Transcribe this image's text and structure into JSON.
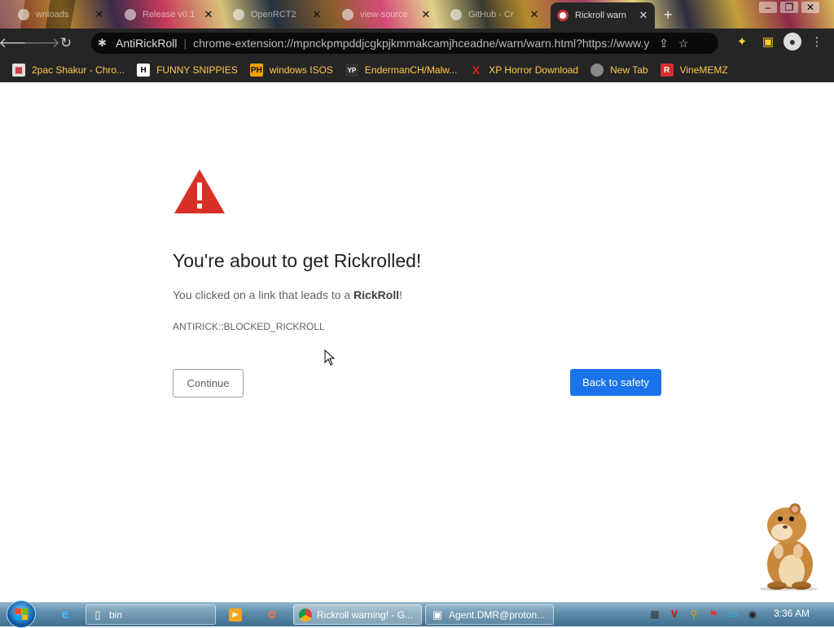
{
  "tabs": [
    {
      "title": "wnloads",
      "active": false
    },
    {
      "title": "Release v0.1",
      "active": false
    },
    {
      "title": "OpenRCT2",
      "active": false
    },
    {
      "title": "view-source",
      "active": false
    },
    {
      "title": "GitHub - Cr",
      "active": false
    },
    {
      "title": "Rickroll warn",
      "active": true
    }
  ],
  "toolbar": {
    "extension_name": "AntiRickRoll",
    "url": "chrome-extension://mpnckpmpddjcgkpjkmmakcamjhceadne/warn/warn.html?https://www.y..."
  },
  "bookmarks": [
    {
      "label": "2pac Shakur - Chro...",
      "icon": "music-icon",
      "icon_text": "",
      "color": "#e0e0e0"
    },
    {
      "label": "FUNNY SNIPPIES",
      "icon": "h-icon",
      "icon_text": "H",
      "color": "#ffffff"
    },
    {
      "label": "windows ISOS",
      "icon": "ph-icon",
      "icon_text": "PH",
      "color": "#f5a200"
    },
    {
      "label": "EndermanCH/Malw...",
      "icon": "yt-icon",
      "icon_text": "YP",
      "color": "#333333"
    },
    {
      "label": "XP Horror Download",
      "icon": "x-icon",
      "icon_text": "X",
      "color": "#e02020"
    },
    {
      "label": "New Tab",
      "icon": "newtab-icon",
      "icon_text": "",
      "color": "#888888"
    },
    {
      "label": "VineMEMZ",
      "icon": "r-icon",
      "icon_text": "R",
      "color": "#d32f2f"
    }
  ],
  "warning": {
    "heading": "You're about to get Rickrolled!",
    "sub_prefix": "You clicked on a link that leads to a ",
    "sub_bold": "RickRoll",
    "sub_suffix": "!",
    "code": "ANTIRICK::BLOCKED_RICKROLL",
    "continue_label": "Continue",
    "safety_label": "Back to safety"
  },
  "taskbar": {
    "items": [
      {
        "label": "bin",
        "icon": "recycle-bin-icon"
      },
      {
        "label": "Rickroll warning! - G...",
        "icon": "chrome-icon"
      },
      {
        "label": "Agent.DMR@proton...",
        "icon": "window-icon"
      }
    ],
    "clock": "3:36 AM"
  }
}
